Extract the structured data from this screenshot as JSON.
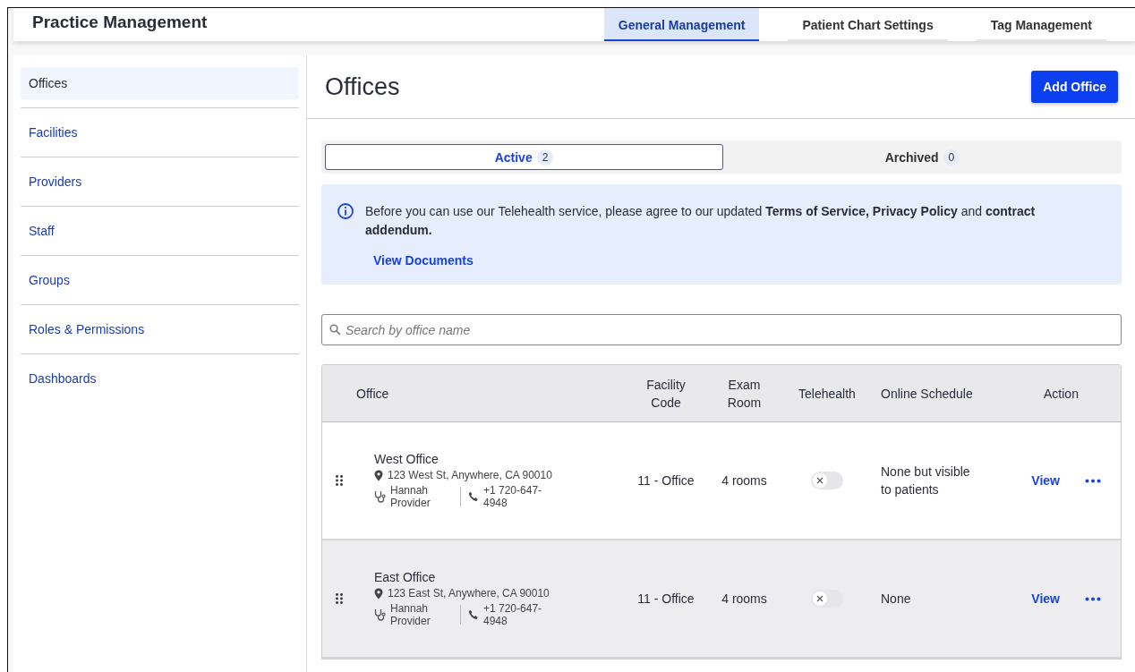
{
  "header": {
    "title": "Practice Management",
    "tabs": [
      {
        "label": "General Management",
        "selected": true
      },
      {
        "label": "Patient Chart Settings",
        "selected": false
      },
      {
        "label": "Tag Management",
        "selected": false
      }
    ]
  },
  "sidebar": {
    "items": [
      {
        "label": "Offices",
        "selected": true
      },
      {
        "label": "Facilities",
        "selected": false
      },
      {
        "label": "Providers",
        "selected": false
      },
      {
        "label": "Staff",
        "selected": false
      },
      {
        "label": "Groups",
        "selected": false
      },
      {
        "label": "Roles & Permissions",
        "selected": false
      },
      {
        "label": "Dashboards",
        "selected": false
      }
    ]
  },
  "page": {
    "title": "Offices",
    "add_button": "Add Office"
  },
  "segments": [
    {
      "label": "Active",
      "count": "2",
      "selected": true
    },
    {
      "label": "Archived",
      "count": "0",
      "selected": false
    }
  ],
  "notice": {
    "text": "Before you can use our Telehealth service, please agree to our updated **Terms of Service, Privacy Policy** and **contract addendum.**",
    "link": "View Documents"
  },
  "search": {
    "placeholder": "Search by office name"
  },
  "table": {
    "columns": [
      "Office",
      "Facility Code",
      "Exam Room",
      "Telehealth",
      "Online Schedule",
      "Action"
    ],
    "rows": [
      {
        "name": "West Office",
        "address": "123 West St, Anywhere, CA 90010",
        "provider": "Hannah Provider",
        "phone": "+1 720-647-4948",
        "facility_code": "11 - Office",
        "exam_room": "4 rooms",
        "telehealth": false,
        "online_schedule": "None but visible to patients",
        "action": "View",
        "highlighted": false
      },
      {
        "name": "East Office",
        "address": "123 East St, Anywhere, CA 90010",
        "provider": "Hannah Provider",
        "phone": "+1 720-647-4948",
        "facility_code": "11 - Office",
        "exam_room": "4 rooms",
        "telehealth": false,
        "online_schedule": "None",
        "action": "View",
        "highlighted": true
      }
    ]
  }
}
